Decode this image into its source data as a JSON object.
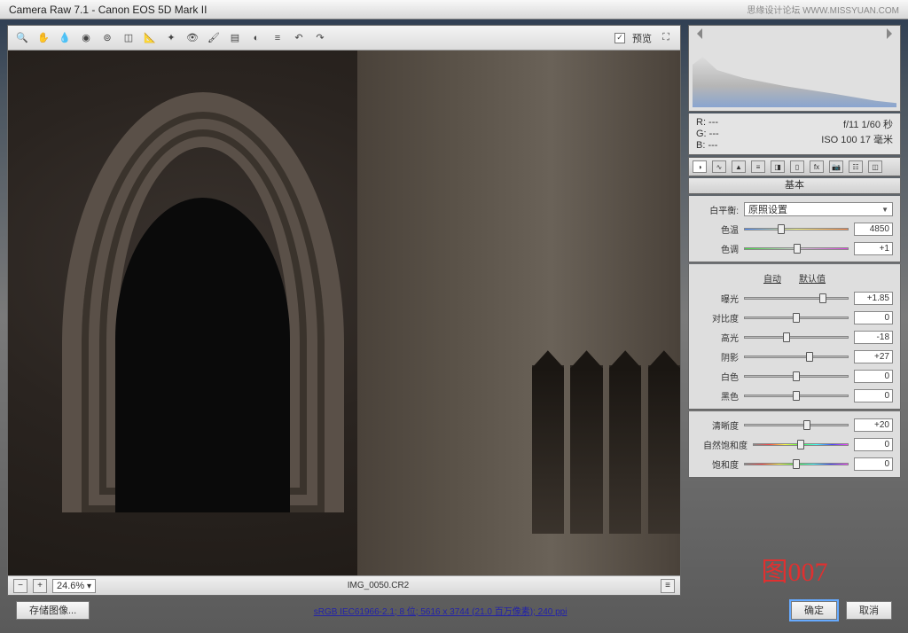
{
  "title": "Camera Raw 7.1  -  Canon EOS 5D Mark II",
  "watermark": "思缘设计论坛  WWW.MISSYUAN.COM",
  "toolbar": {
    "preview_checked": "✓",
    "preview_label": "预览"
  },
  "status": {
    "zoom": "24.6%",
    "filename": "IMG_0050.CR2"
  },
  "meta": {
    "r": "R:  ---",
    "g": "G:  ---",
    "b": "B:  ---",
    "exposure": "f/11  1/60 秒",
    "iso": "ISO 100   17 毫米"
  },
  "panel": {
    "header": "基本",
    "wb_label": "白平衡:",
    "wb_value": "原照设置",
    "auto": "自动",
    "default": "默认值",
    "sliders": {
      "temp": {
        "label": "色温",
        "value": "4850",
        "pos": 36
      },
      "tint": {
        "label": "色调",
        "value": "+1",
        "pos": 51
      },
      "exposure": {
        "label": "曝光",
        "value": "+1.85",
        "pos": 75
      },
      "contrast": {
        "label": "对比度",
        "value": "0",
        "pos": 50
      },
      "highlights": {
        "label": "高光",
        "value": "-18",
        "pos": 41
      },
      "shadows": {
        "label": "阴影",
        "value": "+27",
        "pos": 63
      },
      "whites": {
        "label": "白色",
        "value": "0",
        "pos": 50
      },
      "blacks": {
        "label": "黑色",
        "value": "0",
        "pos": 50
      },
      "clarity": {
        "label": "清晰度",
        "value": "+20",
        "pos": 60
      },
      "vibrance": {
        "label": "自然饱和度",
        "value": "0",
        "pos": 50
      },
      "saturation": {
        "label": "饱和度",
        "value": "0",
        "pos": 50
      }
    }
  },
  "stamp": "图007",
  "bottom": {
    "save": "存储图像...",
    "info": "sRGB IEC61966-2.1; 8 位;  5616 x 3744 (21.0 百万像素); 240 ppi",
    "ok": "确定",
    "cancel": "取消"
  }
}
